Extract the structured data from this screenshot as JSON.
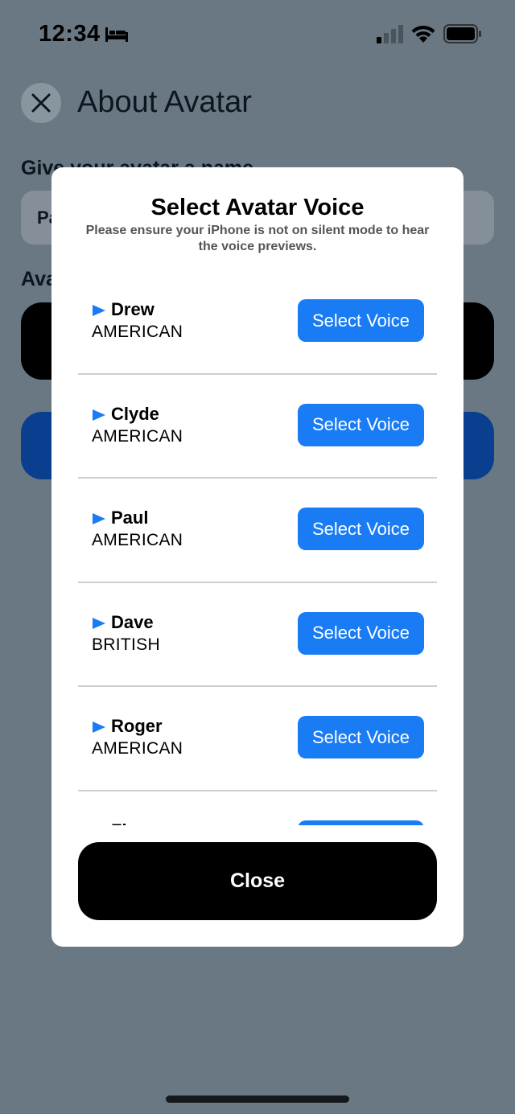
{
  "status_bar": {
    "time": "12:34",
    "icons": [
      "bed-icon",
      "cellular-signal-icon",
      "wifi-icon",
      "battery-icon"
    ]
  },
  "background": {
    "title": "About Avatar",
    "name_label": "Give your avatar a name",
    "name_value": "Pa",
    "section_label": "Ava"
  },
  "modal": {
    "title": "Select Avatar Voice",
    "subtitle": "Please ensure your iPhone is not on silent mode to hear the voice previews.",
    "voices": [
      {
        "name": "Drew",
        "accent": "AMERICAN",
        "button": "Select Voice"
      },
      {
        "name": "Clyde",
        "accent": "AMERICAN",
        "button": "Select Voice"
      },
      {
        "name": "Paul",
        "accent": "AMERICAN",
        "button": "Select Voice"
      },
      {
        "name": "Dave",
        "accent": "BRITISH",
        "button": "Select Voice"
      },
      {
        "name": "Roger",
        "accent": "AMERICAN",
        "button": "Select Voice"
      },
      {
        "name": "Fi",
        "accent": "",
        "button": ""
      }
    ],
    "close_label": "Close"
  },
  "colors": {
    "overlay_background": "#6a7883",
    "accent_blue": "#1a7cf5",
    "play_icon_blue": "#1a7cf5"
  }
}
